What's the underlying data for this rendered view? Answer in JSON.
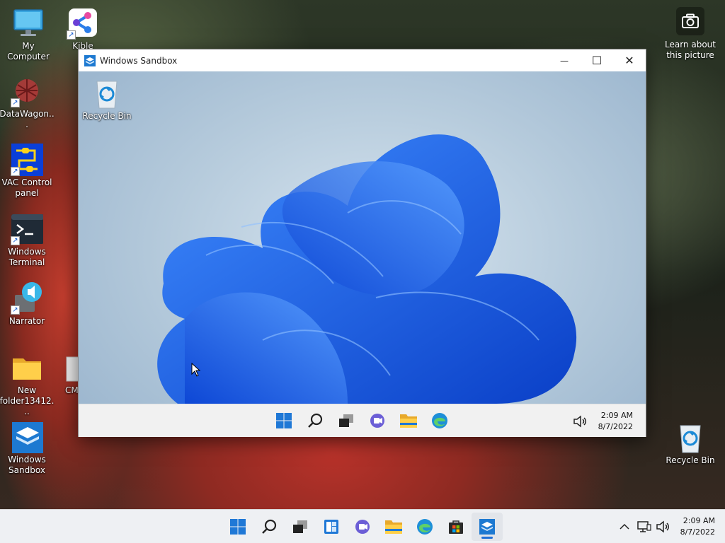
{
  "desktop": {
    "icons": [
      {
        "label": "My Computer"
      },
      {
        "label": "Kible"
      },
      {
        "label": "DataWagon..."
      },
      {
        "label": "VAC Control panel"
      },
      {
        "label": "Windows Terminal"
      },
      {
        "label": "Narrator"
      },
      {
        "label": "New folder13412..."
      },
      {
        "label": "CM"
      },
      {
        "label": "Windows Sandbox"
      },
      {
        "label": "Recycle Bin"
      }
    ],
    "learn_label": "Learn about this picture"
  },
  "sandbox_window": {
    "title": "Windows Sandbox",
    "controls": {
      "minimize": "—",
      "maximize": "☐",
      "close": "✕"
    },
    "desktop": {
      "recycle_bin_label": "Recycle Bin"
    },
    "taskbar": {
      "time": "2:09 AM",
      "date": "8/7/2022"
    }
  },
  "taskbar": {
    "time": "2:09 AM",
    "date": "8/7/2022"
  },
  "colors": {
    "accent": "#1f6fd6",
    "bloom": "#1a5fe0"
  }
}
